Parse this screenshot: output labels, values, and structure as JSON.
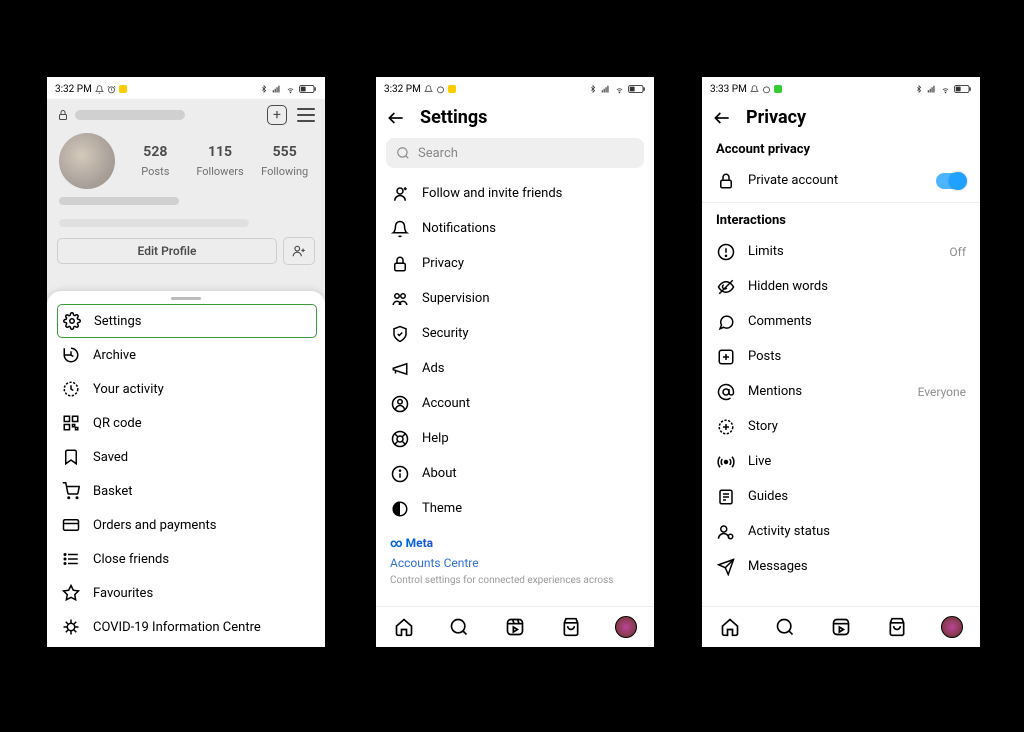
{
  "statusbar": {
    "time1": "3:32 PM",
    "time2": "3:32 PM",
    "time3": "3:33 PM"
  },
  "screen1": {
    "stats": [
      {
        "n": "528",
        "l": "Posts"
      },
      {
        "n": "115",
        "l": "Followers"
      },
      {
        "n": "555",
        "l": "Following"
      }
    ],
    "edit_label": "Edit Profile",
    "menu": [
      "Settings",
      "Archive",
      "Your activity",
      "QR code",
      "Saved",
      "Basket",
      "Orders and payments",
      "Close friends",
      "Favourites",
      "COVID-19 Information Centre"
    ]
  },
  "screen2": {
    "title": "Settings",
    "search_placeholder": "Search",
    "menu": [
      "Follow and invite friends",
      "Notifications",
      "Privacy",
      "Supervision",
      "Security",
      "Ads",
      "Account",
      "Help",
      "About",
      "Theme"
    ],
    "meta_brand": "Meta",
    "meta_link": "Accounts Centre",
    "meta_desc": "Control settings for connected experiences across"
  },
  "screen3": {
    "title": "Privacy",
    "section1": "Account privacy",
    "private_label": "Private account",
    "section2": "Interactions",
    "items": [
      {
        "label": "Limits",
        "value": "Off"
      },
      {
        "label": "Hidden words",
        "value": ""
      },
      {
        "label": "Comments",
        "value": ""
      },
      {
        "label": "Posts",
        "value": ""
      },
      {
        "label": "Mentions",
        "value": "Everyone"
      },
      {
        "label": "Story",
        "value": ""
      },
      {
        "label": "Live",
        "value": ""
      },
      {
        "label": "Guides",
        "value": ""
      },
      {
        "label": "Activity status",
        "value": ""
      },
      {
        "label": "Messages",
        "value": ""
      }
    ]
  }
}
